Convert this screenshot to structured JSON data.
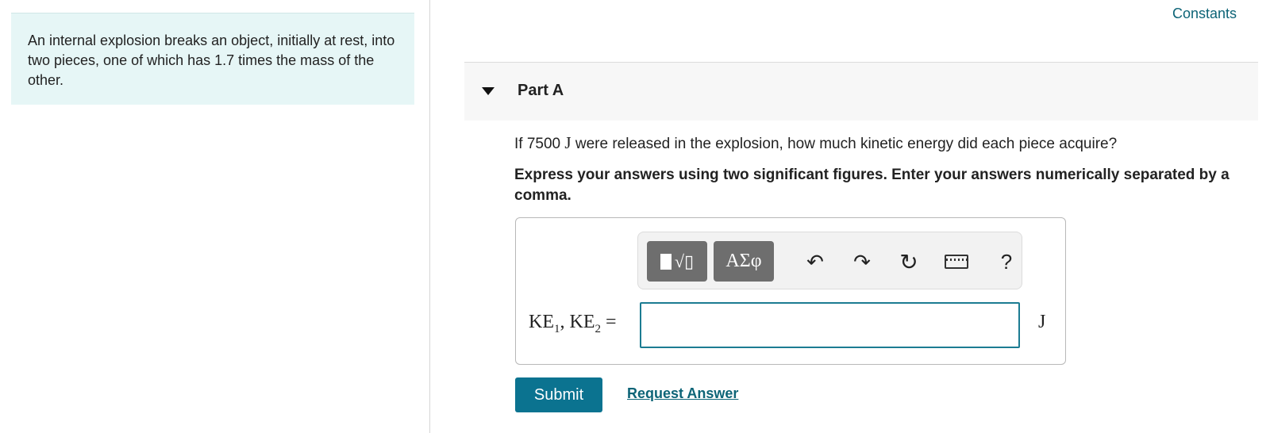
{
  "intro": {
    "text": "An internal explosion breaks an object, initially at rest, into two pieces, one of which has 1.7 times the mass of the other."
  },
  "header": {
    "constants_link": "Constants"
  },
  "part": {
    "title": "Part A",
    "question_before": "If 7500 ",
    "question_unit": "J",
    "question_after": " were released in the explosion, how much kinetic energy did each piece acquire?",
    "instruction": "Express your answers using two significant figures. Enter your answers numerically separated by a comma."
  },
  "toolbar": {
    "templates_icon": "templates-icon",
    "greek_label": "ΑΣφ",
    "undo_icon": "undo-icon",
    "redo_icon": "redo-icon",
    "reset_icon": "reset-icon",
    "keyboard_icon": "keyboard-icon",
    "help_label": "?"
  },
  "answer": {
    "label_ke1": "KE",
    "label_sub1": "1",
    "label_sep": ", KE",
    "label_sub2": "2",
    "label_eq": " =",
    "value": "",
    "placeholder": "",
    "unit": "J"
  },
  "actions": {
    "submit_label": "Submit",
    "request_answer_label": "Request Answer"
  },
  "colors": {
    "intro_bg": "#e6f6f6",
    "accent": "#0b7390",
    "link": "#0d6477"
  }
}
